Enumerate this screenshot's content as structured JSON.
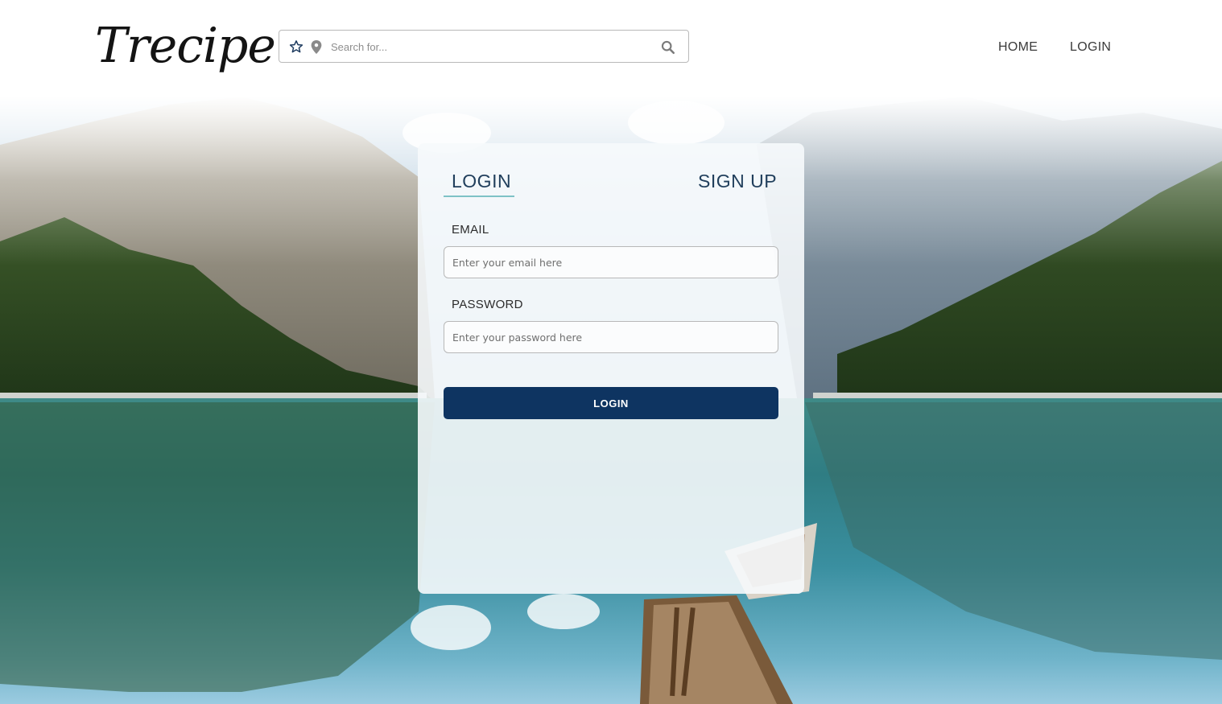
{
  "brand": {
    "logo": "Trecipe"
  },
  "search": {
    "placeholder": "Search for..."
  },
  "nav": {
    "home": "HOME",
    "login": "LOGIN"
  },
  "icons": {
    "favorites": "star-icon",
    "location": "map-pin-icon",
    "search": "search-icon"
  },
  "login_card": {
    "tabs": [
      {
        "label": "LOGIN",
        "active": true
      },
      {
        "label": "SIGN UP",
        "active": false
      }
    ],
    "email": {
      "label": "EMAIL",
      "placeholder": "Enter your email here",
      "value": ""
    },
    "password": {
      "label": "PASSWORD",
      "placeholder": "Enter your password here",
      "value": ""
    },
    "submit_label": "LOGIN"
  },
  "colors": {
    "primary": "#0e3461",
    "tab_text": "#213f5c",
    "tab_accent": "#7ec2c6"
  }
}
